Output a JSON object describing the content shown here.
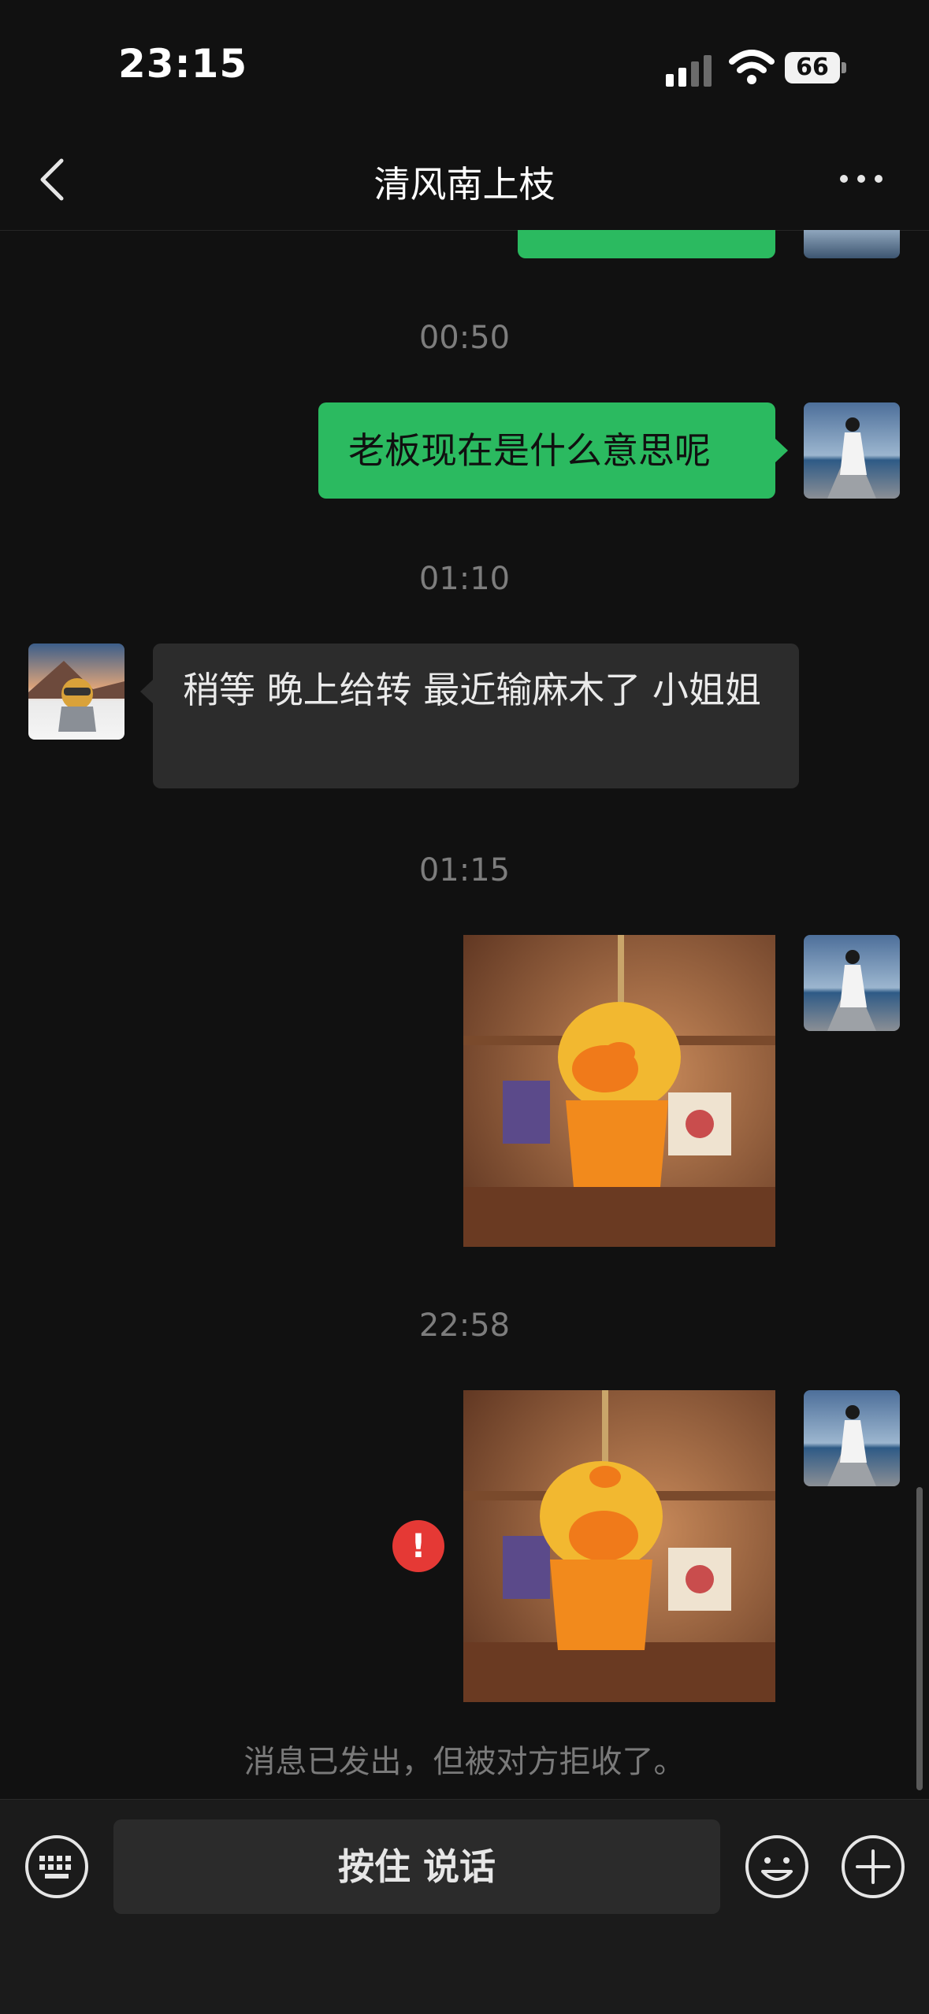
{
  "status_bar": {
    "time": "23:15",
    "battery": "66"
  },
  "header": {
    "title": "清风南上枝"
  },
  "messages": [
    {
      "type": "timestamp",
      "text": "00:50"
    },
    {
      "type": "sent_text",
      "text": "老板现在是什么意思呢"
    },
    {
      "type": "timestamp",
      "text": "01:10"
    },
    {
      "type": "received_text",
      "text": "稍等 晚上给转 最近输麻木了 小姐姐"
    },
    {
      "type": "timestamp",
      "text": "01:15"
    },
    {
      "type": "sent_image",
      "description": "hanging-cartoon-pig"
    },
    {
      "type": "timestamp",
      "text": "22:58"
    },
    {
      "type": "sent_image_failed",
      "description": "hanging-cartoon-pig",
      "error_icon": "!"
    }
  ],
  "system_note": "消息已发出，但被对方拒收了。",
  "input_bar": {
    "talk_label": "按住 说话"
  },
  "colors": {
    "accent_green": "#2bba60",
    "error_red": "#e53935",
    "background": "#111111"
  }
}
